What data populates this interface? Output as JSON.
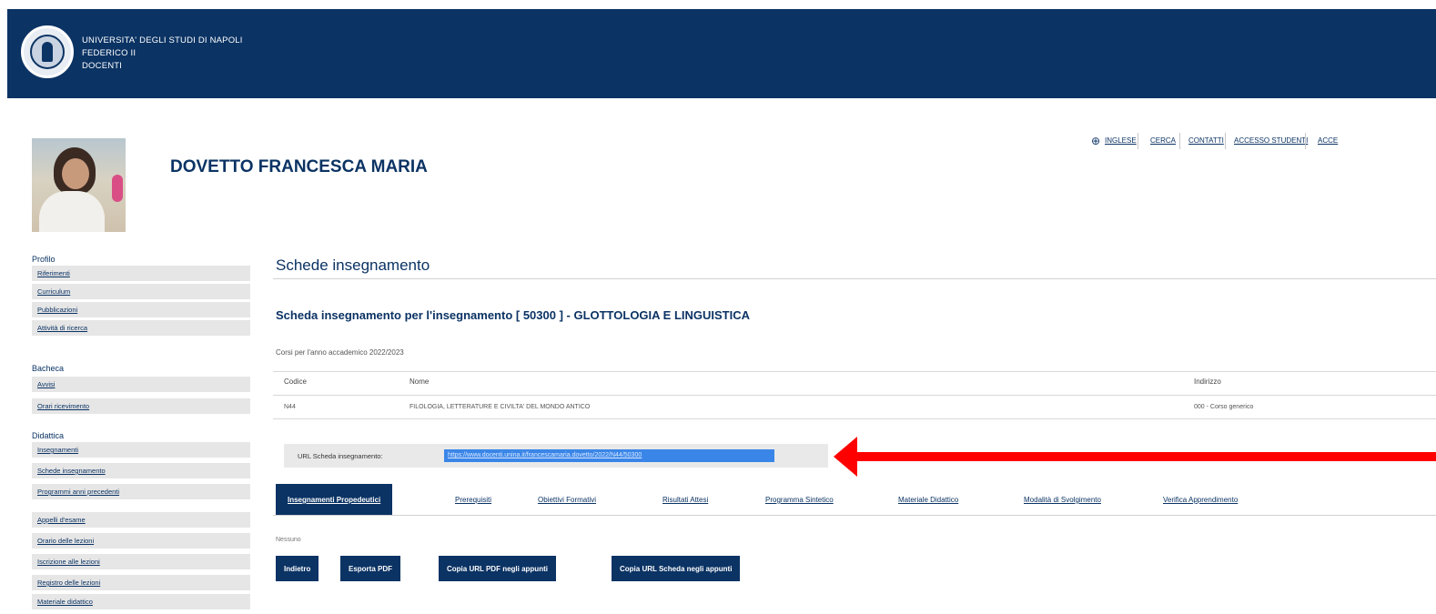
{
  "header": {
    "line1": "UNIVERSITA' DEGLI STUDI DI NAPOLI",
    "line2": "FEDERICO II",
    "line3": "DOCENTI"
  },
  "topnav": [
    {
      "label": "INGLESE"
    },
    {
      "label": "CERCA"
    },
    {
      "label": "CONTATTI"
    },
    {
      "label": "ACCESSO STUDENTI"
    },
    {
      "label": "ACCE"
    }
  ],
  "profile": {
    "name": "DOVETTO FRANCESCA MARIA"
  },
  "sidebar": {
    "profilo": {
      "title": "Profilo",
      "items": [
        "Riferimenti",
        "Curriculum",
        "Pubblicazioni",
        "Attività di ricerca"
      ]
    },
    "bacheca": {
      "title": "Bacheca",
      "items": [
        "Avvisi",
        "Orari ricevimento"
      ]
    },
    "didattica": {
      "title": "Didattica",
      "items": [
        "Insegnamenti",
        "Schede insegnamento",
        "Programmi anni precedenti",
        "Appelli d'esame",
        "Orario delle lezioni",
        "Iscrizione alle lezioni",
        "Registro delle lezioni",
        "Materiale didattico"
      ]
    }
  },
  "main": {
    "title": "Schede insegnamento",
    "scheda_title": "Scheda insegnamento per l'insegnamento [ 50300 ] - GLOTTOLOGIA E LINGUISTICA",
    "corso_label": "Corsi per l'anno accademico 2022/2023",
    "table": {
      "headers": [
        "Codice",
        "Nome",
        "Indirizzo"
      ],
      "rows": [
        [
          "N44",
          "FILOLOGIA, LETTERATURE E CIVILTA' DEL MONDO ANTICO",
          "000 - Corso generico"
        ]
      ]
    },
    "url_label": "URL Scheda insegnamento:",
    "url_value": "https://www.docenti.unina.it/francescamaria.dovetto/2022/N44/50300",
    "tabs": [
      {
        "label": "Insegnamenti Propedeutici",
        "active": true
      },
      {
        "label": "Prerequisiti"
      },
      {
        "label": "Obiettivi Formativi"
      },
      {
        "label": "Risultati Attesi"
      },
      {
        "label": "Programma Sintetico"
      },
      {
        "label": "Materiale Didattico"
      },
      {
        "label": "Modalità di Svolgimento"
      },
      {
        "label": "Verifica Apprendimento"
      }
    ],
    "status": "Nessuno",
    "buttons": [
      "Indietro",
      "Esporta PDF",
      "Copia URL PDF negli appunti",
      "Copia URL Scheda negli appunti"
    ]
  },
  "colors": {
    "brand": "#0b3364",
    "highlight": "#3a86e8",
    "annotation_arrow": "#ff0000"
  }
}
